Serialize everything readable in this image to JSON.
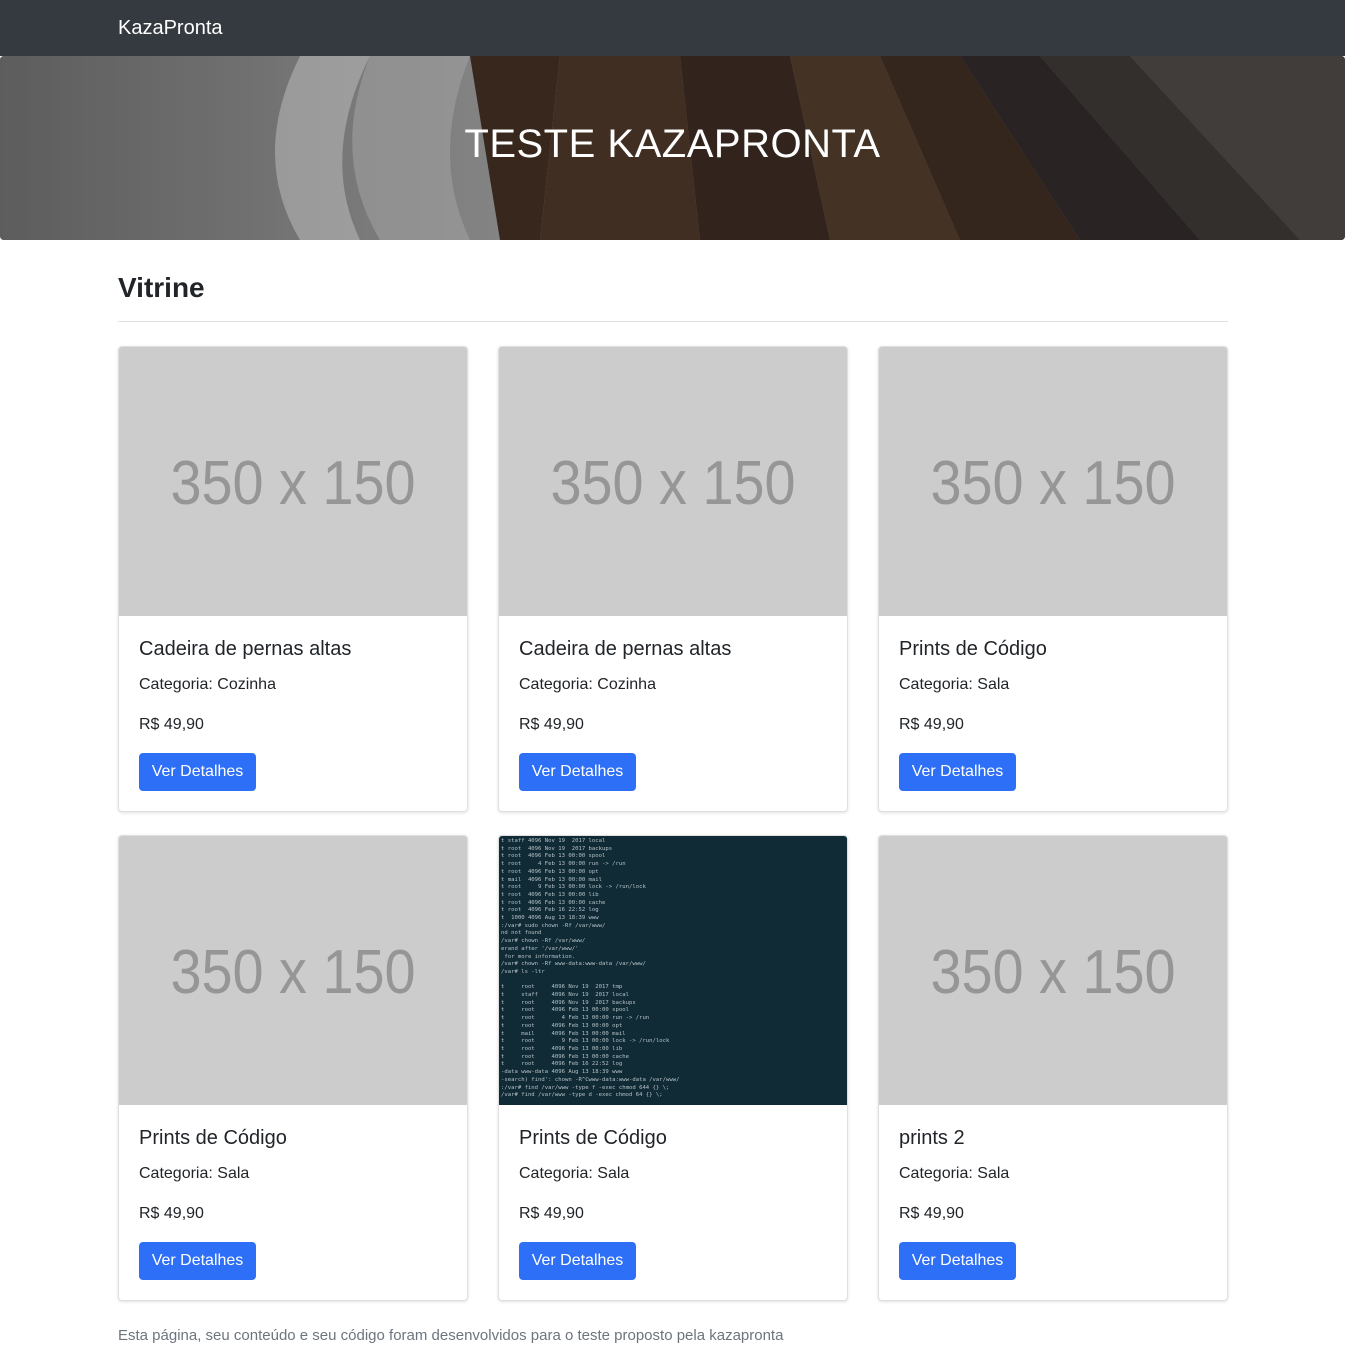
{
  "navbar": {
    "brand": "KazaPronta"
  },
  "hero": {
    "title": "TESTE KAZAPRONTA"
  },
  "section": {
    "title": "Vitrine"
  },
  "products": [
    {
      "title": "Cadeira de pernas altas",
      "category": "Categoria: Cozinha",
      "price": "R$ 49,90",
      "image_text": "350 x 150",
      "button": "Ver Detalhes"
    },
    {
      "title": "Cadeira de pernas altas",
      "category": "Categoria: Cozinha",
      "price": "R$ 49,90",
      "image_text": "350 x 150",
      "button": "Ver Detalhes"
    },
    {
      "title": "Prints de Código",
      "category": "Categoria: Sala",
      "price": "R$ 49,90",
      "image_text": "350 x 150",
      "button": "Ver Detalhes"
    },
    {
      "title": "Prints de Código",
      "category": "Categoria: Sala",
      "price": "R$ 49,90",
      "image_text": "350 x 150",
      "button": "Ver Detalhes"
    },
    {
      "title": "Prints de Código",
      "category": "Categoria: Sala",
      "price": "R$ 49,90",
      "image_text": "",
      "button": "Ver Detalhes"
    },
    {
      "title": "prints 2",
      "category": "Categoria: Sala",
      "price": "R$ 49,90",
      "image_text": "350 x 150",
      "button": "Ver Detalhes"
    }
  ],
  "terminal_lines": "t staff 4096 Nov 19  2017 local\nt root  4096 Nov 19  2017 backups\nt root  4096 Feb 13 00:00 spool\nt root     4 Feb 13 00:00 run -> /run\nt root  4096 Feb 13 00:00 opt\nt mail  4096 Feb 13 00:00 mail\nt root     9 Feb 13 00:00 lock -> /run/lock\nt root  4096 Feb 13 00:00 lib\nt root  4096 Feb 13 00:00 cache\nt root  4096 Feb 16 22:52 log\nt  1000 4096 Aug 13 18:39 www\n:/var# sudo chown -Rf /var/www/\nnd not found\n/var# chown -Rf /var/www/\nerand after '/var/www/'\n for more information.\n/var# chown -Rf www-data:www-data /var/www/\n/var# ls -ltr\n\nt     root     4096 Nov 19  2017 tmp\nt     staff    4096 Nov 19  2017 local\nt     root     4096 Nov 19  2017 backups\nt     root     4096 Feb 13 00:00 spool\nt     root        4 Feb 13 00:00 run -> /run\nt     root     4096 Feb 13 00:00 opt\nt     mail     4096 Feb 13 00:00 mail\nt     root        9 Feb 13 00:00 lock -> /run/lock\nt     root     4096 Feb 13 00:00 lib\nt     root     4096 Feb 13 00:00 cache\nt     root     4096 Feb 16 22:52 log\n-data www-data 4096 Aug 13 18:39 www\n-search) find': chown -R^Cwww-data:www-data /var/www/\n:/var# find /var/www -type f -exec chmod 644 {} \\;\n/var# find /var/www -type d -exec chmod 64 {} \\;",
  "footer": {
    "text": "Esta página, seu conteúdo e seu código foram desenvolvidos para o teste proposto pela kazapronta"
  },
  "colors": {
    "navbar": "#343a40",
    "button": "#2d6ff7",
    "placeholder": "#cccccc",
    "terminal": "#102a36"
  }
}
